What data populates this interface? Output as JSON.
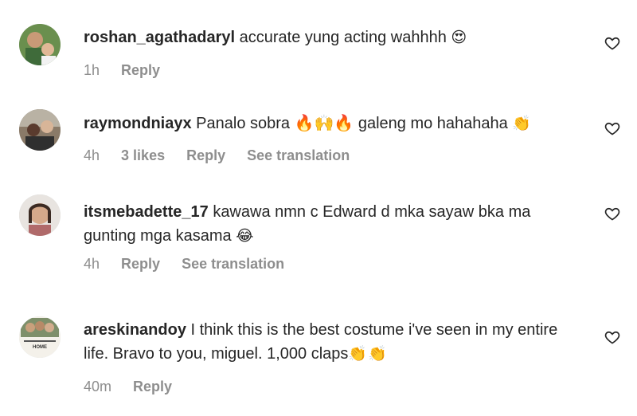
{
  "comments": [
    {
      "username": "roshan_agathadaryl",
      "text": "accurate yung acting wahhhh",
      "emoji_after": "😍",
      "time": "1h",
      "likes": "",
      "reply": "Reply",
      "translation": ""
    },
    {
      "username": "raymondniayx",
      "text": "Panalo sobra 🔥🙌🔥 galeng mo hahahaha",
      "emoji_after": "👏",
      "time": "4h",
      "likes": "3 likes",
      "reply": "Reply",
      "translation": "See translation"
    },
    {
      "username": "itsmebadette_17",
      "text": "kawawa nmn c Edward d mka sayaw bka ma gunting mga kasama",
      "emoji_after": "😂",
      "time": "4h",
      "likes": "",
      "reply": "Reply",
      "translation": "See translation"
    },
    {
      "username": "areskinandoy",
      "text": "I think this is the best costume i've seen in my entire life. Bravo to you, miguel. 1,000 claps",
      "emoji_after": "👏👏",
      "time": "40m",
      "likes": "",
      "reply": "Reply",
      "translation": "",
      "avatar_caption": "HOME"
    }
  ]
}
